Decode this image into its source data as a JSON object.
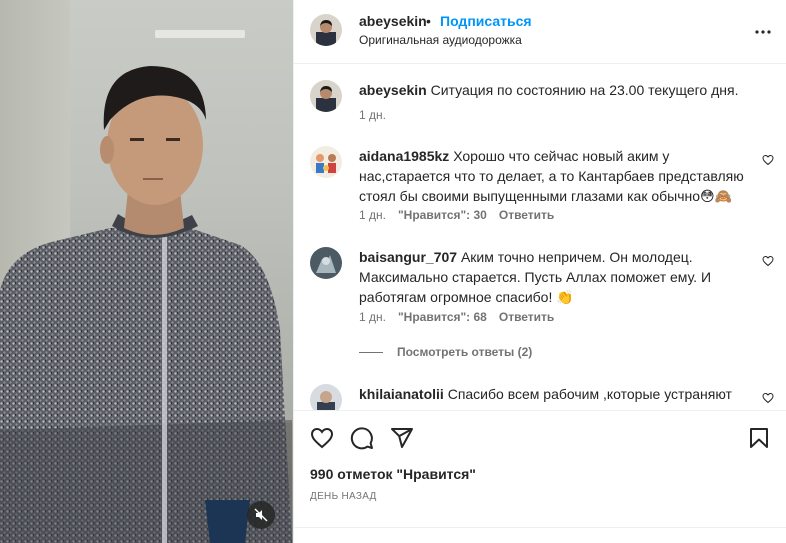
{
  "post": {
    "author": "abeysekin",
    "follow_label": "Подписаться",
    "dot": "•",
    "audio": "Оригинальная аудиодорожка",
    "caption": "Ситуация по состоянию на 23.00 текущего дня.",
    "caption_time": "1 дн."
  },
  "comments": [
    {
      "user": "aidana1985kz",
      "text": "Хорошо что сейчас новый аким у нас,старается что то делает, а то Кантарбаев представляю стоял бы своими выпущенными глазами как обычно😳🙈",
      "time": "1 дн.",
      "likes": "\"Нравится\": 30",
      "reply": "Ответить"
    },
    {
      "user": "baisangur_707",
      "text": "Аким точно непричем. Он молодец. Максимально старается. Пусть Аллах поможет ему. И работягам огромное спасибо! 👏",
      "time": "1 дн.",
      "likes": "\"Нравится\": 68",
      "reply": "Ответить"
    },
    {
      "user": "khilaianatolii",
      "text": "Спасибо всем рабочим ,которые устраняют"
    }
  ],
  "view_replies": "Посмотреть ответы (2)",
  "likes_count": "990 отметок \"Нравится\"",
  "date_label": "ДЕНЬ НАЗАД",
  "icons": {
    "like": "heart-icon",
    "comment": "comment-icon",
    "share": "share-icon",
    "save": "bookmark-icon",
    "more": "more-icon",
    "mute": "muted-speaker-icon"
  }
}
